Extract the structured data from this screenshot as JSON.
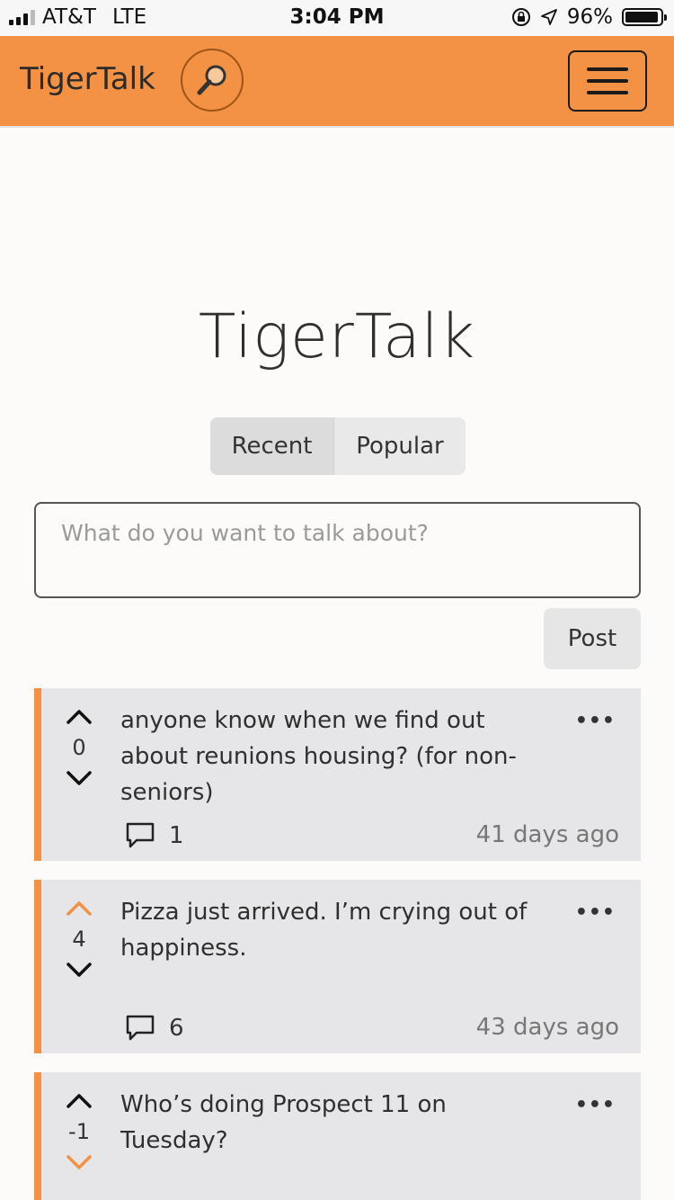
{
  "status_bar": {
    "carrier": "AT&T",
    "network": "LTE",
    "time": "3:04 PM",
    "battery": "96%",
    "battery_level": 0.96,
    "icons": [
      "signal-icon",
      "rotation-lock-icon",
      "location-icon",
      "battery-icon"
    ]
  },
  "navbar": {
    "brand": "TigerTalk",
    "search_icon": "magnifier-icon",
    "menu_icon": "hamburger-icon"
  },
  "main": {
    "title": "TigerTalk",
    "tabs": [
      {
        "label": "Recent",
        "active": true
      },
      {
        "label": "Popular",
        "active": false
      }
    ],
    "composer_placeholder": "What do you want to talk about?",
    "post_button": "Post"
  },
  "colors": {
    "accent": "#f39244",
    "card": "#e6e6e8"
  },
  "posts": [
    {
      "text": "anyone know when we find out about reunions housing? (for non-seniors)",
      "score": "0",
      "upvoted": false,
      "downvoted": false,
      "comments": "1",
      "age": "41 days ago"
    },
    {
      "text": "Pizza just arrived. I’m crying out of happiness.",
      "score": "4",
      "upvoted": true,
      "downvoted": false,
      "comments": "6",
      "age": "43 days ago"
    },
    {
      "text": "Who’s doing Prospect 11 on Tuesday?",
      "score": "-1",
      "upvoted": false,
      "downvoted": true
    }
  ],
  "more_label": "•••"
}
